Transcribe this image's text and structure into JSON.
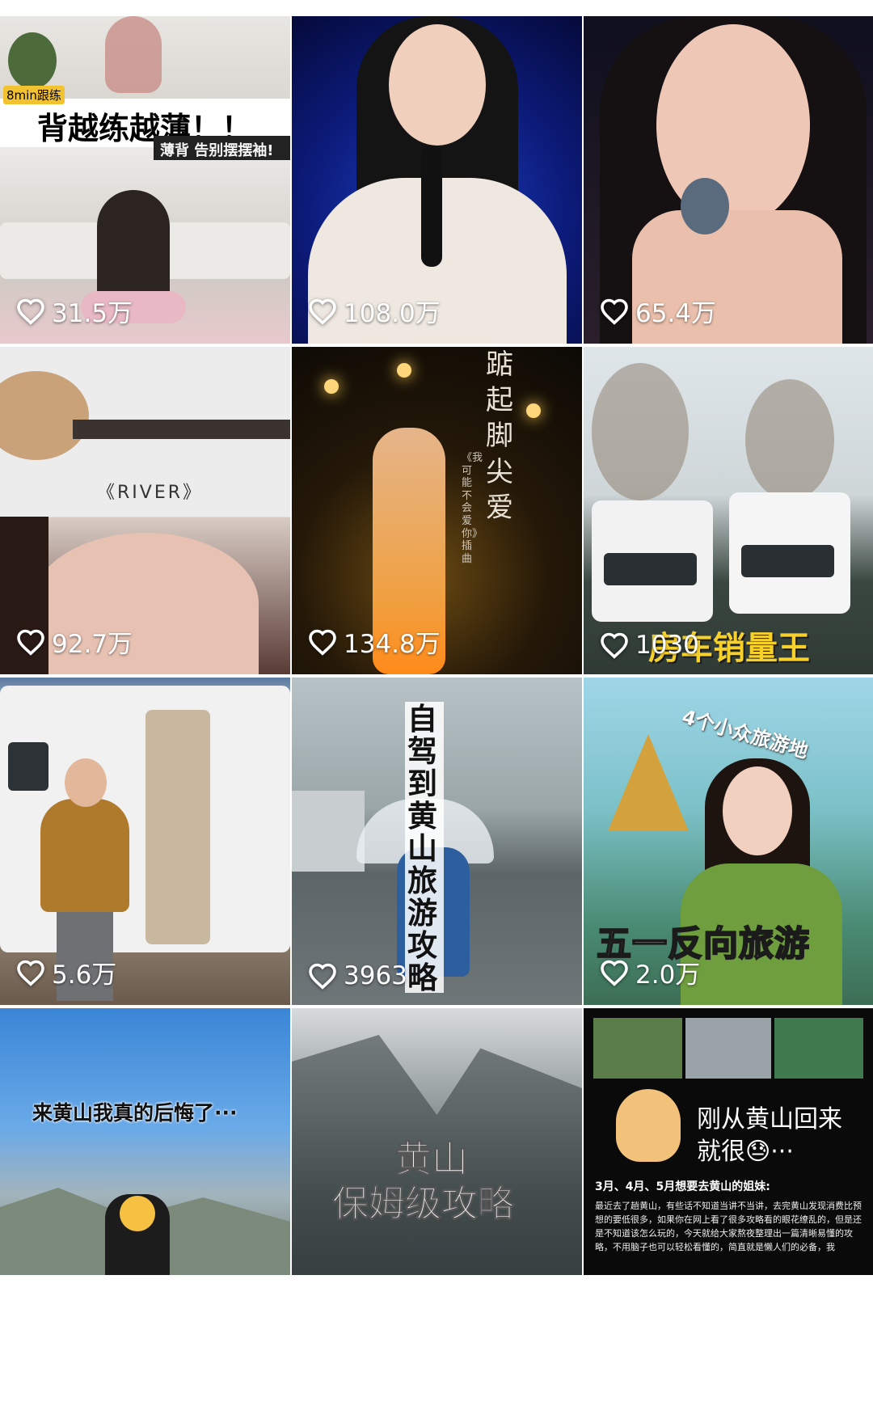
{
  "tiles": [
    {
      "likes": "31.5万",
      "badge": "8min跟练",
      "title": "背越练越薄！！",
      "subtitle": "薄背 告别摆摆袖!"
    },
    {
      "likes": "108.0万"
    },
    {
      "likes": "65.4万"
    },
    {
      "likes": "92.7万",
      "title": "《RIVER》"
    },
    {
      "likes": "134.8万",
      "title": "踮起脚尖爱",
      "subtitle": "《我可能不会爱你》插曲"
    },
    {
      "likes": "1030",
      "title": "房车销量王"
    },
    {
      "likes": "5.6万"
    },
    {
      "likes": "3963",
      "title": "自驾到黄山旅游攻略"
    },
    {
      "likes": "2.0万",
      "title": "五一反向旅游",
      "subtitle": "4个小众旅游地"
    },
    {
      "title": "来黄山我真的后悔了···"
    },
    {
      "title": "黄山",
      "subtitle": "保姆级攻略"
    },
    {
      "title": "刚从黄山回来",
      "title2": "就很😓···",
      "subtitle": "3月、4月、5月想要去黄山的姐妹:",
      "body": "最近去了趟黄山，有些话不知道当讲不当讲，去完黄山发现消费比预想的要低很多，如果你在网上看了很多攻略看的眼花缭乱的，但是还是不知道该怎么玩的，今天就给大家熬夜整理出一篇清晰易懂的攻略，不用脑子也可以轻松看懂的，简直就是懒人们的必备，我"
    }
  ],
  "icons": {
    "like": "heart-outline-icon"
  }
}
